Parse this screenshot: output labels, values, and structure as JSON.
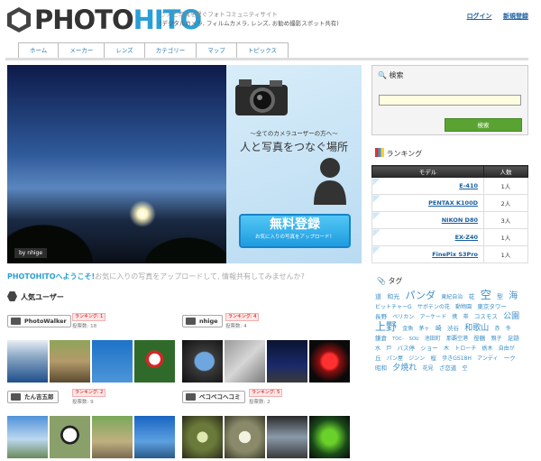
{
  "header": {
    "logo_part1": "PHOTO",
    "logo_part2": "HITO",
    "tagline_line1": "○ 人と写真を繋ぐフォトコミュニティサイト",
    "tagline_line2": "(デジタルカメラ, フィルムカメラ, レンズ, お勧め撮影スポット共有)",
    "login": "ログイン",
    "register": "新規登録"
  },
  "nav": {
    "tabs": [
      "ホーム",
      "メーカー",
      "レンズ",
      "カテゴリー",
      "マップ",
      "トピックス"
    ]
  },
  "hero": {
    "credit": "by nhige",
    "banner_sub": "〜全てのカメラユーザーの方へ〜",
    "banner_main": "人と写真をつなぐ場所",
    "register_big": "無料登録",
    "register_small": "お気に入りの写真をアップロード！"
  },
  "welcome": {
    "highlight": "PHOTOHITOへようこそ!",
    "rest": "お気に入りの写真をアップロードして, 情報共有してみませんか?"
  },
  "users": {
    "heading": "人気ユーザー",
    "list": [
      {
        "name": "PhotoWalker",
        "rank": "ランキング: 1",
        "votes": "投票数: 18"
      },
      {
        "name": "nhige",
        "rank": "ランキング: 4",
        "votes": "投票数: 4"
      },
      {
        "name": "たん吉五郎",
        "rank": "ランキング: 2",
        "votes": "投票数: 9"
      },
      {
        "name": "ベコベコヘコミ",
        "rank": "ランキング: 5",
        "votes": "投票数: 2"
      }
    ]
  },
  "search": {
    "heading": "検索",
    "placeholder": "",
    "button": "検索"
  },
  "ranking": {
    "heading": "ランキング",
    "col_model": "モデル",
    "col_count": "人数",
    "rows": [
      {
        "model": "E-410",
        "count": "1人"
      },
      {
        "model": "PENTAX K100D",
        "count": "2人"
      },
      {
        "model": "NIKON D80",
        "count": "3人"
      },
      {
        "model": "EX-Z40",
        "count": "1人"
      },
      {
        "model": "FinePix S3Pro",
        "count": "1人"
      }
    ]
  },
  "tags": {
    "heading": "タグ",
    "items": [
      "道",
      "和光",
      "パンダ",
      "東紀自治",
      "花",
      "空",
      "型",
      "海",
      "ビットチャーG",
      "サボテンの花",
      "動物園",
      "東京タワー",
      "長野",
      "ペリカン",
      "アーケード",
      "携",
      "帯",
      "コスモス",
      "公園",
      "上野",
      "金魚",
      "茅ヶ",
      "崎",
      "渋谷",
      "和歌山",
      "赤",
      "冬",
      "鎌倉",
      "TOC-",
      "SOU",
      "池田町",
      "那覇空港",
      "笹鶴",
      "親子",
      "足跡",
      "水",
      "戸",
      "バス停",
      "ショー",
      "木",
      "トローチ",
      "栃木",
      "自由が",
      "丘",
      "パン屋",
      "ジンン",
      "桜",
      "歩きGS18H",
      "アンディ",
      "ーク",
      "昭和",
      "夕焼れ",
      "花見",
      "ざ恋道",
      "空"
    ]
  },
  "colors": {
    "accent": "#2a9fd6",
    "search_button": "#5aa332"
  }
}
